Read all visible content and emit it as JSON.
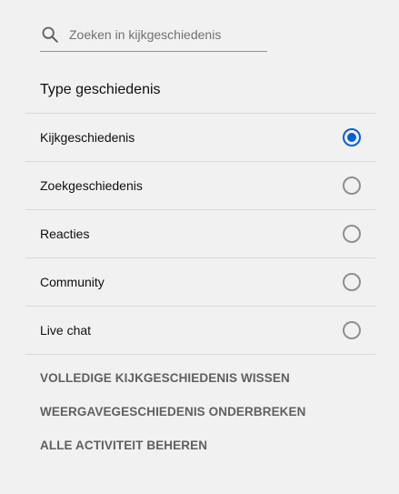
{
  "search": {
    "placeholder": "Zoeken in kijkgeschiedenis",
    "icon": "search-icon"
  },
  "history_type": {
    "title": "Type geschiedenis",
    "options": [
      {
        "label": "Kijkgeschiedenis",
        "selected": true
      },
      {
        "label": "Zoekgeschiedenis",
        "selected": false
      },
      {
        "label": "Reacties",
        "selected": false
      },
      {
        "label": "Community",
        "selected": false
      },
      {
        "label": "Live chat",
        "selected": false
      }
    ]
  },
  "actions": {
    "clear_all": "VOLLEDIGE KIJKGESCHIEDENIS WISSEN",
    "pause": "WEERGAVEGESCHIEDENIS ONDERBREKEN",
    "manage": "ALLE ACTIVITEIT BEHEREN"
  },
  "colors": {
    "background": "#f1f1f1",
    "accent": "#065fd4",
    "action_text": "#606060",
    "divider": "#d9d9d9"
  }
}
